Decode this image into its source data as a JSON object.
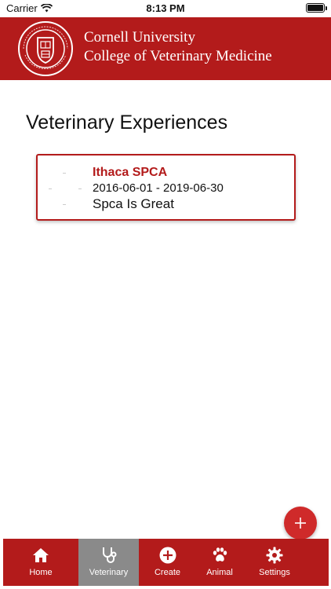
{
  "status_bar": {
    "carrier": "Carrier",
    "time": "8:13 PM"
  },
  "header": {
    "university": "Cornell University",
    "college": "College of Veterinary Medicine",
    "seal_text": "CORNELL UNIVERSITY · FOUNDED A.D. 1865"
  },
  "main": {
    "title": "Veterinary Experiences",
    "experiences": [
      {
        "name": "Ithaca SPCA",
        "dates": "2016-06-01 - 2019-06-30",
        "description": "Spca Is Great"
      }
    ]
  },
  "fab": {
    "icon": "plus-icon"
  },
  "tabbar": {
    "tabs": [
      {
        "label": "Home",
        "icon": "home-icon",
        "active": false
      },
      {
        "label": "Veterinary",
        "icon": "stethoscope-icon",
        "active": true
      },
      {
        "label": "Create",
        "icon": "plus-circle-icon",
        "active": false
      },
      {
        "label": "Animal",
        "icon": "paw-icon",
        "active": false
      },
      {
        "label": "Settings",
        "icon": "gear-icon",
        "active": false
      }
    ]
  },
  "colors": {
    "brand_red": "#b31b1b",
    "active_tab": "#8a8a8a",
    "fab_red": "#cf2a2a"
  }
}
